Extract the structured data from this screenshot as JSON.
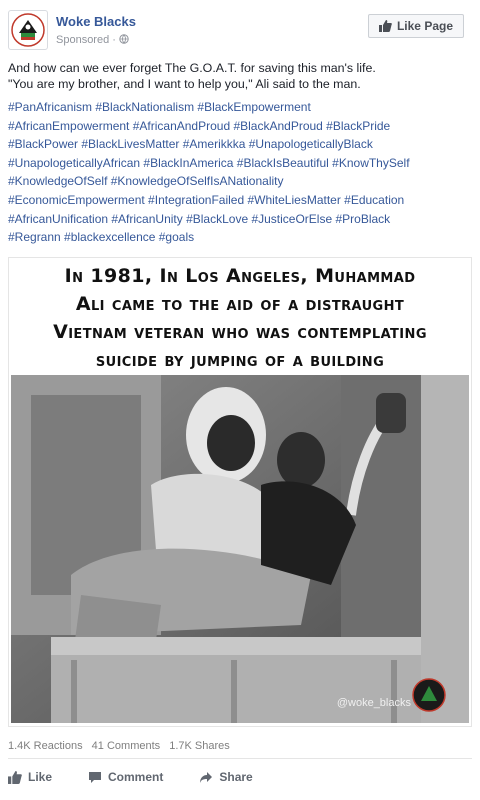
{
  "post": {
    "page_name": "Woke Blacks",
    "sponsored": "Sponsored · ",
    "like_page_label": "Like Page",
    "text_line1": "And how can we ever forget The G.O.A.T. for saving this man's life.",
    "text_line2": "\"You are my brother, and I want to help you,\" Ali said to the man.",
    "hashtags": [
      "#PanAfricanism #BlackNationalism #BlackEmpowerment",
      "#AfricanEmpowerment #AfricanAndProud #BlackAndProud #BlackPride",
      "#BlackPower #BlackLivesMatter #Amerikkka #UnapologeticallyBlack",
      "#UnapologeticallyAfrican #BlackInAmerica #BlackIsBeautiful #KnowThySelf",
      "#KnowledgeOfSelf #KnowledgeOfSelfIsANationality",
      "#EconomicEmpowerment #IntegrationFailed #WhiteLiesMatter #Education",
      "#AfricanUnification #AfricanUnity #BlackLove #JusticeOrElse #ProBlack",
      "#Regrann #blackexcellence #goals"
    ]
  },
  "image": {
    "headline_line1": "In 1981, In Los Angeles, Muhammad",
    "headline_line2": "Ali came to the aid of a distraught",
    "headline_line3": "Vietnam veteran who was contemplating",
    "headline_line4": "suicide by jumping of a building",
    "watermark": "@woke_blacks"
  },
  "stats": {
    "reactions": "1.4K Reactions",
    "comments": "41 Comments",
    "shares": "1.7K Shares"
  },
  "actions": {
    "like": "Like",
    "comment": "Comment",
    "share": "Share"
  },
  "colors": {
    "link": "#365899",
    "meta": "#90949c"
  },
  "icons": {
    "avatar": "woke-blacks-logo",
    "globe": "globe-icon",
    "like": "thumbs-up-icon",
    "comment": "comment-bubble-icon",
    "share": "share-arrow-icon"
  }
}
